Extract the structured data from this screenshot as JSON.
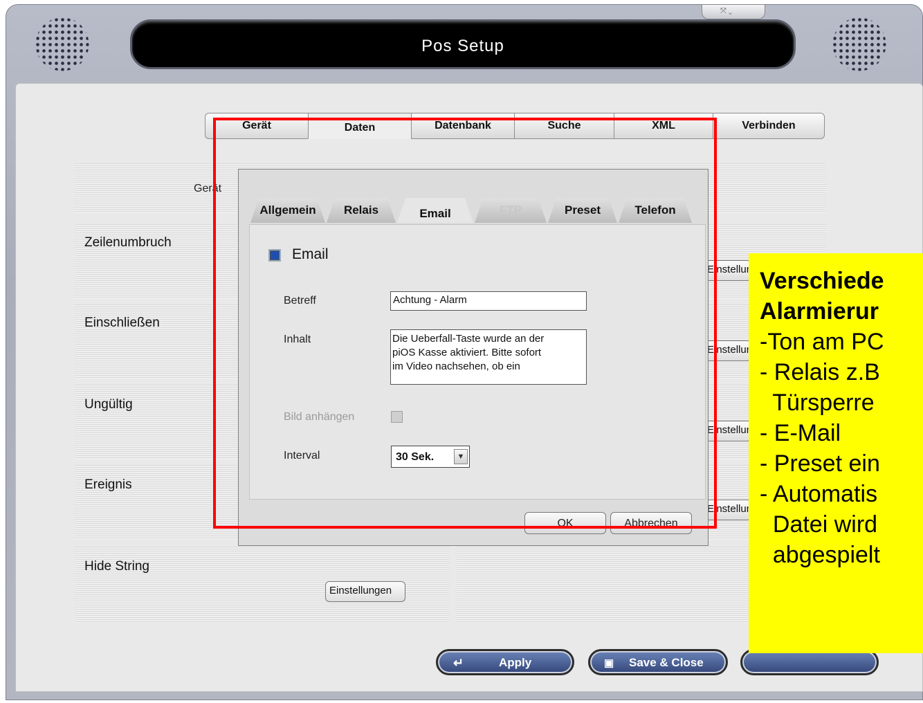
{
  "window": {
    "title": "Pos Setup",
    "controls_label": "⤧ ⌄"
  },
  "top_tabs": [
    "Gerät",
    "Daten",
    "Datenbank",
    "Suche",
    "XML",
    "Verbinden"
  ],
  "left_panel": {
    "device_label": "Gerät",
    "rows": [
      {
        "label": "Zeilenumbruch",
        "button": "Einstellungen"
      },
      {
        "label": "Einschließen",
        "button": "Einstellungen"
      },
      {
        "label": "Ungültig",
        "button": "Einstellungen"
      },
      {
        "label": "Ereignis",
        "button": "Einstellungen"
      },
      {
        "label": "Hide String",
        "button": "Einstellungen"
      }
    ]
  },
  "dialog": {
    "tabs": [
      "Allgemein",
      "Relais",
      "Email",
      "FTP",
      "Preset",
      "Telefon"
    ],
    "email_checkbox_label": "Email",
    "subject_label": "Betreff",
    "subject_value": "Achtung - Alarm",
    "content_label": "Inhalt",
    "content_lines": [
      "Die Ueberfall-Taste wurde an der",
      "piOS Kasse aktiviert. Bitte sofort",
      "im Video nachsehen, ob ein"
    ],
    "attach_image_label": "Bild anhängen",
    "interval_label": "Interval",
    "interval_value": "30 Sek.",
    "ok_label": "OK",
    "cancel_label": "Abbrechen"
  },
  "callout": {
    "line1": "Verschiede",
    "line2": "Alarmierur",
    "line3": "-Ton am PC",
    "line4": "- Relais z.B",
    "line5": "  Türsperre",
    "line6": "- E-Mail",
    "line7": "- Preset ein",
    "line8": "- Automatis",
    "line9": "  Datei wird",
    "line10": "  abgespielt"
  },
  "bottom_buttons": {
    "apply": "Apply",
    "save_close": "Save & Close"
  },
  "colors": {
    "annotation_red": "#ff0000",
    "callout_yellow": "#ffff00",
    "title_bar": "#000000"
  }
}
